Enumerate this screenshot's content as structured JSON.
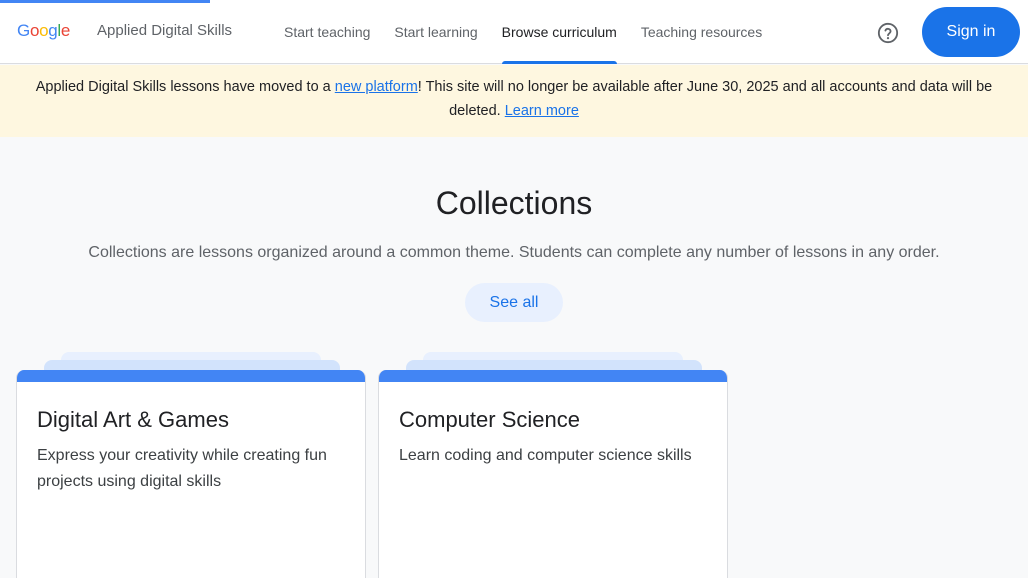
{
  "header": {
    "logo_letters": [
      "G",
      "o",
      "o",
      "g",
      "l",
      "e"
    ],
    "app_name": "Applied Digital Skills",
    "nav": [
      {
        "label": "Start teaching",
        "active": false
      },
      {
        "label": "Start learning",
        "active": false
      },
      {
        "label": "Browse curriculum",
        "active": true
      },
      {
        "label": "Teaching resources",
        "active": false
      }
    ],
    "help_icon": "help-circle-icon",
    "signin_label": "Sign in"
  },
  "banner": {
    "text_before": "Applied Digital Skills lessons have moved to a ",
    "link1": "new platform",
    "text_after": "! This site will no longer be available after June 30, 2025 and all accounts and data will be deleted. ",
    "link2": "Learn more"
  },
  "main": {
    "title": "Collections",
    "subtitle": "Collections are lessons organized around a common theme. Students can complete any number of lessons in any order.",
    "see_all_label": "See all",
    "cards": [
      {
        "title": "Digital Art & Games",
        "description": "Express your creativity while creating fun projects using digital skills"
      },
      {
        "title": "Computer Science",
        "description": "Learn coding and computer science skills"
      }
    ]
  },
  "colors": {
    "accent": "#1a73e8",
    "card_bar": "#4285f4",
    "banner_bg": "#fef7e0"
  }
}
